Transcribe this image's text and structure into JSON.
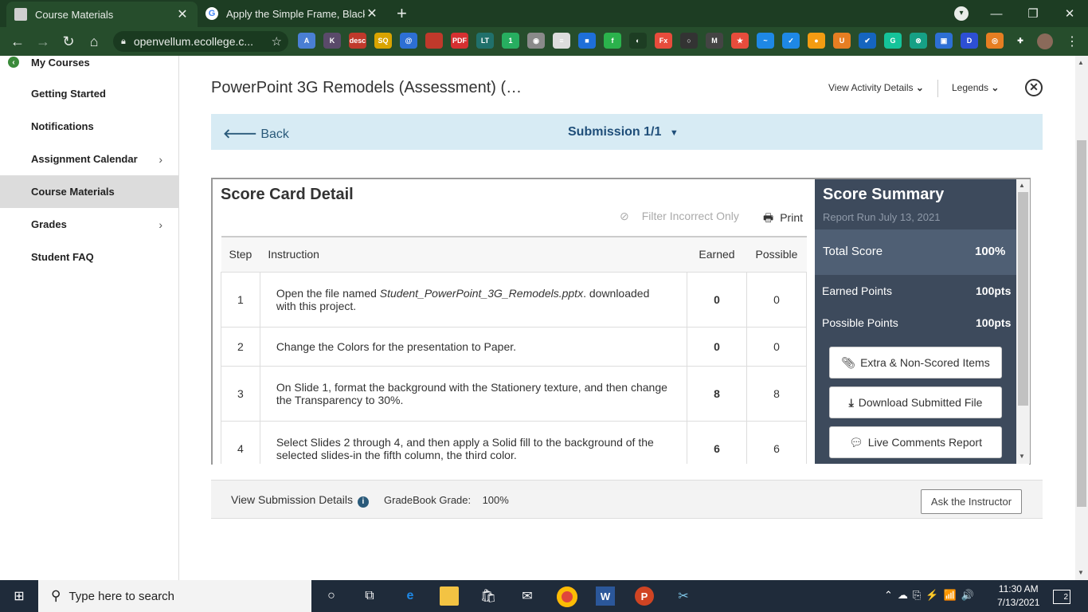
{
  "browser": {
    "tabs": [
      {
        "title": "Course Materials",
        "active": true
      },
      {
        "title": "Apply the Simple Frame, Black vi",
        "active": false
      }
    ],
    "url": "openvellum.ecollege.c...",
    "extensions": [
      {
        "name": "ext-a",
        "color": "#4a7fd4",
        "label": "A"
      },
      {
        "name": "ext-k",
        "color": "#5a4a6a",
        "label": "K"
      },
      {
        "name": "ext-desc",
        "color": "#c0392b",
        "label": "desc"
      },
      {
        "name": "ext-sq",
        "color": "#d9a400",
        "label": "SQ"
      },
      {
        "name": "ext-circle-a",
        "color": "#2d6fd4",
        "label": "@"
      },
      {
        "name": "ext-red",
        "color": "#c0392b",
        "label": ""
      },
      {
        "name": "ext-pdf",
        "color": "#d63031",
        "label": "PDF"
      },
      {
        "name": "ext-lt",
        "color": "#20706b",
        "label": "LT"
      },
      {
        "name": "ext-green",
        "color": "#27ae60",
        "label": "1"
      },
      {
        "name": "ext-globe",
        "color": "#8a8a8a",
        "label": "◉"
      },
      {
        "name": "ext-doc",
        "color": "#dddddd",
        "label": "≡"
      },
      {
        "name": "ext-blue",
        "color": "#1e6fd9",
        "label": "■"
      },
      {
        "name": "ext-feedly",
        "color": "#2bb24c",
        "label": "f"
      },
      {
        "name": "ext-dark",
        "color": "#1d3d23",
        "label": "◐"
      },
      {
        "name": "ext-fx",
        "color": "#e74c3c",
        "label": "Fx"
      },
      {
        "name": "ext-ring",
        "color": "#333333",
        "label": "○"
      },
      {
        "name": "ext-m",
        "color": "#444444",
        "label": "M"
      },
      {
        "name": "ext-star",
        "color": "#e74c3c",
        "label": "★"
      },
      {
        "name": "ext-wave",
        "color": "#1e88e5",
        "label": "~"
      },
      {
        "name": "ext-check",
        "color": "#1e88e5",
        "label": "✓"
      },
      {
        "name": "ext-bulb",
        "color": "#f39c12",
        "label": "●"
      },
      {
        "name": "ext-u",
        "color": "#e67e22",
        "label": "U"
      },
      {
        "name": "ext-tick",
        "color": "#1565c0",
        "label": "✔"
      },
      {
        "name": "ext-grammarly",
        "color": "#15c39a",
        "label": "G"
      },
      {
        "name": "ext-swirl",
        "color": "#16a085",
        "label": "⊗"
      },
      {
        "name": "ext-screen",
        "color": "#2d6fd4",
        "label": "▣"
      },
      {
        "name": "ext-d",
        "color": "#2d4fd4",
        "label": "D"
      },
      {
        "name": "ext-chrome",
        "color": "#e67e22",
        "label": "◎"
      },
      {
        "name": "ext-puzzle",
        "color": "#264d2c",
        "label": "✚"
      }
    ]
  },
  "sidebar": {
    "back_label": "My Courses",
    "items": [
      {
        "label": "Getting Started",
        "chevron": false,
        "active": false
      },
      {
        "label": "Notifications",
        "chevron": false,
        "active": false
      },
      {
        "label": "Assignment Calendar",
        "chevron": true,
        "active": false
      },
      {
        "label": "Course Materials",
        "chevron": false,
        "active": true
      },
      {
        "label": "Grades",
        "chevron": true,
        "active": false
      },
      {
        "label": "Student FAQ",
        "chevron": false,
        "active": false
      }
    ]
  },
  "header": {
    "title": "PowerPoint 3G Remodels (Assessment) (…",
    "view_activity": "View Activity Details",
    "legends": "Legends"
  },
  "submission_bar": {
    "back": "Back",
    "submission": "Submission 1/1"
  },
  "scorecard": {
    "title": "Score Card Detail",
    "filter": "Filter Incorrect Only",
    "print": "Print",
    "columns": [
      "Step",
      "Instruction",
      "Earned",
      "Possible"
    ],
    "rows": [
      {
        "step": "1",
        "pre": "Open the file named ",
        "italic": "Student_PowerPoint_3G_Remodels.pptx",
        "post": ". downloaded with this project.",
        "earned": "0",
        "possible": "0"
      },
      {
        "step": "2",
        "pre": "Change the Colors for the presentation to Paper.",
        "italic": "",
        "post": "",
        "earned": "0",
        "possible": "0"
      },
      {
        "step": "3",
        "pre": "On Slide 1, format the background with the Stationery texture, and then change the Transparency to 30%.",
        "italic": "",
        "post": "",
        "earned": "8",
        "possible": "8"
      },
      {
        "step": "4",
        "pre": "Select Slides 2 through 4, and then apply a Solid fill to the background of the selected slides-in the fifth column, the third color.",
        "italic": "",
        "post": "",
        "earned": "6",
        "possible": "6"
      }
    ]
  },
  "summary": {
    "title": "Score Summary",
    "date": "Report Run July 13, 2021",
    "total_label": "Total Score",
    "total_value": "100%",
    "earned_label": "Earned Points",
    "earned_value": "100pts",
    "possible_label": "Possible Points",
    "possible_value": "100pts",
    "btn_extra": "Extra & Non-Scored Items",
    "btn_download": "Download Submitted File",
    "btn_comments": "Live Comments Report"
  },
  "footer": {
    "view_details": "View Submission Details",
    "gradebook_label": "GradeBook Grade:",
    "gradebook_value": "100%",
    "ask": "Ask the Instructor"
  },
  "taskbar": {
    "search_placeholder": "Type here to search",
    "time": "11:30 AM",
    "date": "7/13/2021",
    "notification_count": "2"
  }
}
